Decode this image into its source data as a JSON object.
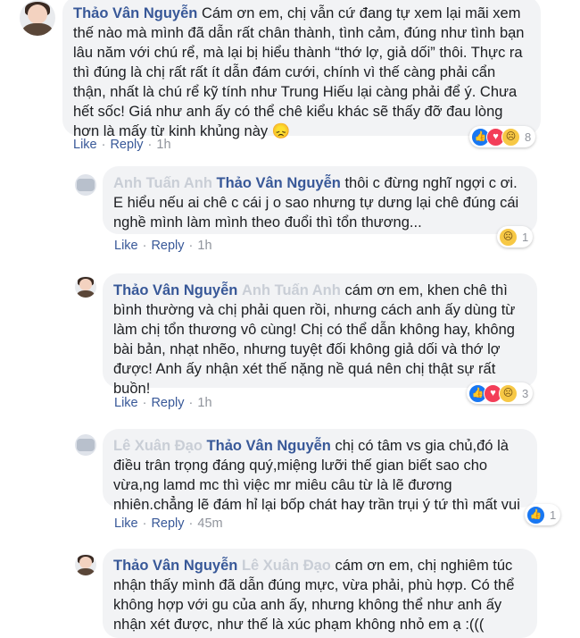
{
  "comments": [
    {
      "author": "Thảo Vân Nguyễn",
      "mention": "",
      "text": "Cám ơn em, chị vẫn cứ đang tự xem lại mãi xem thế nào mà mình đã dẫn rất chân thành, tình cảm, đúng như tình bạn lâu năm với chú rể, mà lại bị hiểu thành “thớ lợ, giả dối” thôi. Thực ra thì đúng là chị rất rất ít dẫn đám cưới, chính vì thế càng phải cẩn thận, nhất là chú rể kỹ tính như Trung Hiếu lại càng phải để ý. Chưa hết sốc! Giá như anh ấy có thể chê kiểu khác sẽ thấy đỡ đau lòng hơn là mấy từ kinh khủng này 😞",
      "like_label": "Like",
      "reply_label": "Reply",
      "time": "1h",
      "reaction_count": "8"
    },
    {
      "author": "Anh Tuấn Anh",
      "mention": "Thảo Vân Nguyễn",
      "text": "thôi c đừng nghĩ ngợi c ơi. E hiểu nếu ai chê c cái j o sao nhưng tự dưng lại chê đúng cái nghề mình làm mình theo đuổi thì tổn thương...",
      "like_label": "Like",
      "reply_label": "Reply",
      "time": "1h",
      "reaction_count": "1"
    },
    {
      "author": "Thảo Vân Nguyễn",
      "mention": "Anh Tuấn Anh",
      "text": "cám ơn em, khen chê thì bình thường và chị phải quen rồi, nhưng cách anh ấy dùng từ làm chị tổn thương vô cùng! Chị có thể dẫn không hay, không bài bản, nhạt nhẽo, nhưng tuyệt đối không giả dối và thớ lợ được! Anh ấy nhận xét thế nặng nề quá nên chị thật sự rất buồn!",
      "like_label": "Like",
      "reply_label": "Reply",
      "time": "1h",
      "reaction_count": "3"
    },
    {
      "author": "Lê Xuân Đạo",
      "mention": "Thảo Vân Nguyễn",
      "text": "chị có tâm vs gia chủ,đó là điều trân trọng đáng quý,miệng lưỡi thế gian biết sao cho vừa,ng lamd mc thì việc mr miêu câu từ là lẽ đương nhiên.chẳng lẽ đám hỉ lại bốp chát hay trần trụi ý tứ thì mất vui",
      "like_label": "Like",
      "reply_label": "Reply",
      "time": "45m",
      "reaction_count": "1"
    },
    {
      "author": "Thảo Vân Nguyễn",
      "mention": "Lê Xuân Đạo",
      "text": "cám ơn em, chị nghiêm túc nhận thấy mình đã dẫn đúng mực, vừa phải, phù hợp. Có thể không hợp với gu của anh ấy, nhưng không thể như anh ấy nhận xét được, như thế là xúc phạm không nhỏ em ạ :(((",
      "like_label": "",
      "reply_label": "",
      "time": "",
      "reaction_count": ""
    }
  ],
  "colors": {
    "link": "#385898",
    "bubble": "#f2f3f5",
    "like": "#1877f2",
    "love": "#f33e58",
    "sad": "#f7c845"
  },
  "icons": [
    "like-reaction-icon",
    "love-reaction-icon",
    "sad-reaction-icon"
  ]
}
